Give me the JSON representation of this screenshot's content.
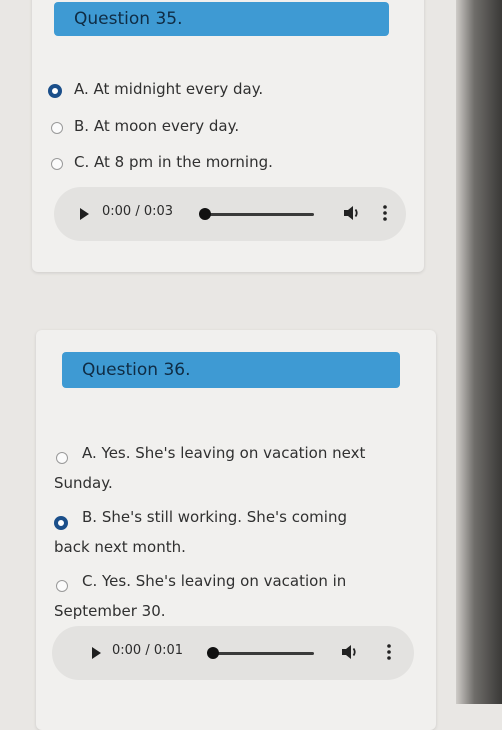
{
  "questions": [
    {
      "title": "Question 35.",
      "options": [
        {
          "text": "A. At midnight every day.",
          "selected": true
        },
        {
          "text": "B. At moon every day.",
          "selected": false
        },
        {
          "text": "C. At 8 pm in the morning.",
          "selected": false
        }
      ],
      "player": {
        "time": "0:00 / 0:03",
        "progress": 0
      }
    },
    {
      "title": "Question 36.",
      "options": [
        {
          "line1": "A. Yes. She's leaving on vacation next",
          "line2": "Sunday.",
          "selected": false
        },
        {
          "line1": "B. She's still working. She's coming",
          "line2": "back next month.",
          "selected": true
        },
        {
          "line1": "C. Yes. She's leaving on vacation in",
          "line2": "September 30.",
          "selected": false
        }
      ],
      "player": {
        "time": "0:00 / 0:01",
        "progress": 0
      }
    }
  ],
  "colors": {
    "header": "#3e9ad3",
    "selected_radio": "#1b4f8a"
  }
}
